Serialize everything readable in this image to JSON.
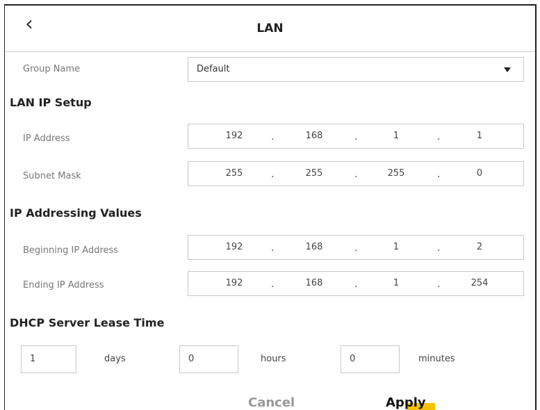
{
  "header": {
    "back_icon": "chevron-left-icon",
    "title": "LAN"
  },
  "group": {
    "label": "Group Name",
    "value": "Default"
  },
  "lan_ip_setup": {
    "heading": "LAN IP Setup",
    "ip_address": {
      "label": "IP Address",
      "octets": [
        "192",
        "168",
        "1",
        "1"
      ]
    },
    "subnet_mask": {
      "label": "Subnet Mask",
      "octets": [
        "255",
        "255",
        "255",
        "0"
      ]
    }
  },
  "ip_addressing": {
    "heading": "IP Addressing Values",
    "beginning": {
      "label": "Beginning IP Address",
      "octets": [
        "192",
        "168",
        "1",
        "2"
      ]
    },
    "ending": {
      "label": "Ending IP Address",
      "octets": [
        "192",
        "168",
        "1",
        "254"
      ]
    }
  },
  "dhcp": {
    "heading": "DHCP Server Lease Time",
    "days": {
      "value": "1",
      "unit": "days"
    },
    "hours": {
      "value": "0",
      "unit": "hours"
    },
    "minutes": {
      "value": "0",
      "unit": "minutes"
    }
  },
  "actions": {
    "cancel": "Cancel",
    "apply": "Apply"
  },
  "colors": {
    "apply_accent": "#f5c200",
    "cancel_text": "#999999"
  }
}
